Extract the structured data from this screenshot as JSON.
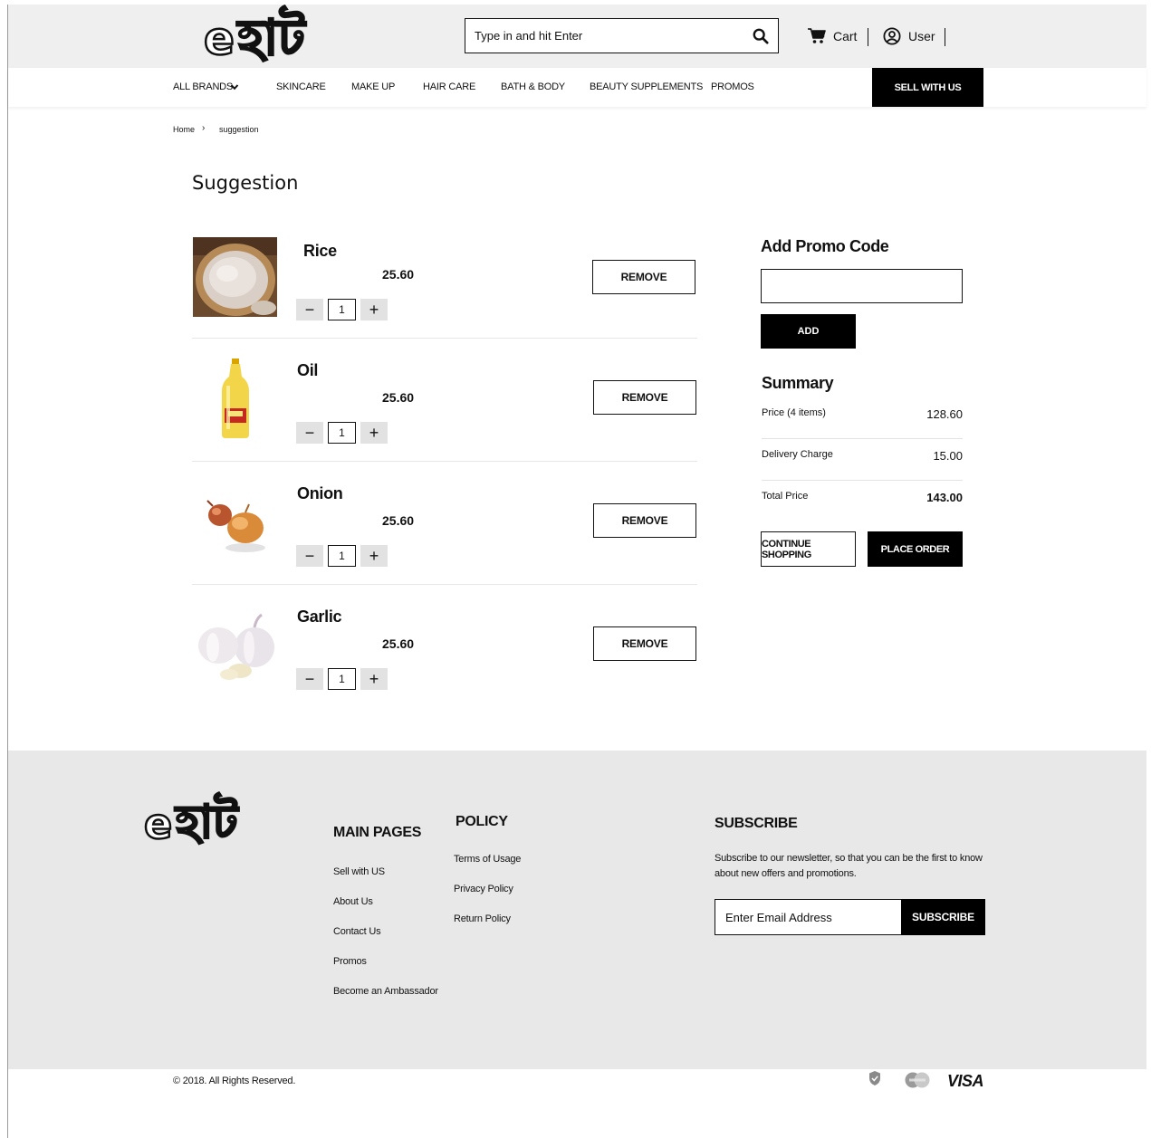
{
  "brand": {
    "logo_e": "e",
    "logo_bn": "হাট"
  },
  "header": {
    "search_placeholder": "Type in and hit Enter",
    "cart_label": "Cart",
    "user_label": "User"
  },
  "nav": {
    "items": [
      "ALL BRANDS",
      "SKINCARE",
      "MAKE UP",
      "HAIR CARE",
      "BATH & BODY",
      "BEAUTY SUPPLEMENTS",
      "PROMOS"
    ],
    "sell_label": "SELL WITH US"
  },
  "breadcrumb": {
    "home": "Home",
    "sep": "›",
    "current": "suggestion"
  },
  "page_title": "Suggestion",
  "products": [
    {
      "name": "Rice",
      "price": "25.60",
      "qty": "1",
      "remove_label": "REMOVE",
      "minus": "−",
      "plus": "+"
    },
    {
      "name": "Oil",
      "price": "25.60",
      "qty": "1",
      "remove_label": "REMOVE",
      "minus": "−",
      "plus": "+"
    },
    {
      "name": "Onion",
      "price": "25.60",
      "qty": "1",
      "remove_label": "REMOVE",
      "minus": "−",
      "plus": "+"
    },
    {
      "name": "Garlic",
      "price": "25.60",
      "qty": "1",
      "remove_label": "REMOVE",
      "minus": "−",
      "plus": "+"
    }
  ],
  "promo": {
    "title": "Add Promo Code",
    "value": "",
    "add_label": "ADD"
  },
  "summary": {
    "title": "Summary",
    "price_label": "Price (4 items)",
    "price_value": "128.60",
    "delivery_label": "Delivery Charge",
    "delivery_value": "15.00",
    "total_label": "Total Price",
    "total_value": "143.00",
    "continue_label": "CONTINUE SHOPPING",
    "order_label": "PLACE ORDER"
  },
  "footer": {
    "main_pages_title": "MAIN PAGES",
    "main_pages": [
      "Sell with US",
      "About Us",
      "Contact Us",
      "Promos",
      "Become an Ambassador"
    ],
    "policy_title": "POLICY",
    "policy": [
      "Terms of Usage",
      "Privacy Policy",
      "Return Policy"
    ],
    "subscribe_title": "SUBSCRIBE",
    "subscribe_text": "Subscribe to our newsletter, so that you can be the first to know about new offers and promotions.",
    "email_placeholder": "Enter Email Address",
    "subscribe_label": "SUBSCRIBE",
    "copyright": "© 2018. All Rights Reserved.",
    "visa": "VISA"
  },
  "icons": {
    "search": "search-icon",
    "cart": "cart-icon",
    "user": "user-icon",
    "chevron": "chevron-down-icon",
    "shield": "shield-icon",
    "mastercard": "mastercard-icon"
  }
}
